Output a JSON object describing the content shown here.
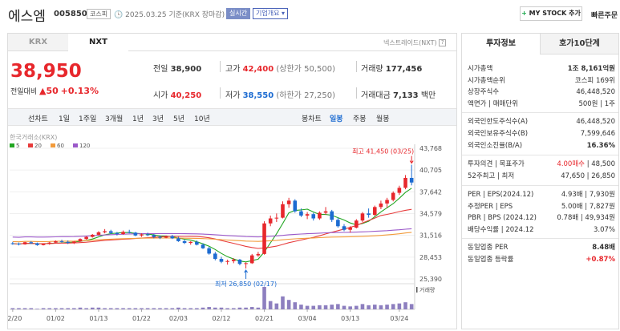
{
  "header": {
    "name": "에스엠",
    "code": "005850",
    "market": "코스피",
    "date_text": "2025.03.25 기준(KRX 장마감)",
    "realtime": "실시간",
    "company_info": "기업개요",
    "mystock": "MY STOCK 추가",
    "quick_order": "빠른주문"
  },
  "tabs": {
    "krx": "KRX",
    "nxt": "NXT",
    "nextrade": "넥스트레이드(NXT)"
  },
  "price": {
    "current": "38,950",
    "change_label": "전일대비",
    "change": "▲50",
    "change_pct": "+0.13%"
  },
  "quote": {
    "prev_label": "전일",
    "prev": "38,900",
    "high_label": "고가",
    "high": "42,400",
    "upper_label": "(상한가",
    "upper": "50,500)",
    "volume_label": "거래량",
    "volume": "177,456",
    "open_label": "시가",
    "open": "40,250",
    "low_label": "저가",
    "low": "38,550",
    "lower_label": "(하한가",
    "lower": "27,250)",
    "amount_label": "거래대금",
    "amount": "7,133",
    "amount_unit": "백만"
  },
  "periods": [
    "선차트",
    "1일",
    "1주일",
    "3개월",
    "1년",
    "3년",
    "5년",
    "10년"
  ],
  "chart_tabs": [
    "봉차트",
    "일봉",
    "주봉",
    "월봉"
  ],
  "chart_labels": {
    "source": "한국거래소(KRX)",
    "ma": [
      "5",
      "20",
      "60",
      "120"
    ],
    "ma_colors": [
      "#22a622",
      "#e73b3b",
      "#f29b3b",
      "#9b59c9"
    ],
    "max_label": "최고 41,450 (03/25)",
    "min_label": "최저 26,850 (02/17)",
    "volume_label": "거래량"
  },
  "chart_data": {
    "type": "candlestick",
    "y_ticks": [
      "43,768",
      "40,705",
      "37,642",
      "34,579",
      "31,516",
      "28,453",
      "25,390"
    ],
    "x_ticks": [
      "12/20",
      "01/02",
      "01/13",
      "01/22",
      "02/03",
      "02/12",
      "02/21",
      "03/04",
      "03/13",
      "03/24"
    ],
    "ylim": [
      25390,
      43768
    ],
    "candles": [
      [
        30400,
        30600,
        30200,
        30350
      ],
      [
        30350,
        30500,
        30100,
        30250
      ],
      [
        30250,
        30600,
        30200,
        30550
      ],
      [
        30550,
        30700,
        30300,
        30400
      ],
      [
        30400,
        30500,
        30050,
        30150
      ],
      [
        30150,
        30400,
        30100,
        30350
      ],
      [
        30350,
        30600,
        30200,
        30500
      ],
      [
        30500,
        30800,
        30400,
        30700
      ],
      [
        30700,
        30900,
        30500,
        30600
      ],
      [
        30600,
        30800,
        30300,
        30450
      ],
      [
        30450,
        30700,
        30300,
        30650
      ],
      [
        30650,
        31100,
        30600,
        31000
      ],
      [
        31000,
        31400,
        30900,
        31300
      ],
      [
        31300,
        31700,
        31200,
        31600
      ],
      [
        31600,
        32100,
        31500,
        31950
      ],
      [
        31950,
        32400,
        31800,
        32100
      ],
      [
        32100,
        32300,
        31700,
        31850
      ],
      [
        31850,
        32000,
        31500,
        31700
      ],
      [
        31700,
        32200,
        31600,
        32000
      ],
      [
        32000,
        32300,
        31800,
        31900
      ],
      [
        31900,
        32000,
        31400,
        31500
      ],
      [
        31500,
        31800,
        31300,
        31650
      ],
      [
        31650,
        31900,
        31400,
        31550
      ],
      [
        31550,
        31700,
        31100,
        31300
      ],
      [
        31300,
        31500,
        31000,
        31200
      ],
      [
        31200,
        31500,
        31100,
        31400
      ],
      [
        31400,
        31600,
        31000,
        31100
      ],
      [
        31100,
        31300,
        30600,
        30700
      ],
      [
        30700,
        30900,
        30300,
        30450
      ],
      [
        30450,
        30700,
        30200,
        30600
      ],
      [
        30600,
        30800,
        30100,
        30200
      ],
      [
        30200,
        30400,
        29600,
        29700
      ],
      [
        29700,
        29900,
        28800,
        28950
      ],
      [
        28950,
        29200,
        28000,
        28200
      ],
      [
        28200,
        28500,
        27600,
        27800
      ],
      [
        27800,
        28100,
        27400,
        27900
      ],
      [
        27900,
        28300,
        27600,
        28100
      ],
      [
        28100,
        28200,
        27300,
        27500
      ],
      [
        27500,
        27700,
        26850,
        27600
      ],
      [
        27600,
        28900,
        27500,
        28700
      ],
      [
        28700,
        29200,
        28500,
        28900
      ],
      [
        28900,
        33500,
        28800,
        33200
      ],
      [
        33200,
        34300,
        32800,
        33900
      ],
      [
        33900,
        34600,
        33400,
        34000
      ],
      [
        34000,
        36300,
        33900,
        35900
      ],
      [
        35900,
        36800,
        35400,
        36400
      ],
      [
        36400,
        36600,
        34700,
        34900
      ],
      [
        34900,
        35300,
        34100,
        34300
      ],
      [
        34300,
        34800,
        33800,
        34500
      ],
      [
        34500,
        34700,
        33600,
        33900
      ],
      [
        33900,
        34900,
        33700,
        34700
      ],
      [
        34700,
        35500,
        34400,
        34900
      ],
      [
        34900,
        35100,
        33400,
        33700
      ],
      [
        33700,
        34000,
        32600,
        32800
      ],
      [
        32800,
        33100,
        32100,
        32300
      ],
      [
        32300,
        32800,
        31900,
        32600
      ],
      [
        32600,
        33800,
        32500,
        33600
      ],
      [
        33600,
        34800,
        33400,
        34600
      ],
      [
        34600,
        35300,
        34000,
        34400
      ],
      [
        34400,
        35700,
        34200,
        35500
      ],
      [
        35500,
        36400,
        35200,
        36000
      ],
      [
        36000,
        36800,
        35400,
        36500
      ],
      [
        36500,
        37700,
        36300,
        37500
      ],
      [
        37500,
        38500,
        37200,
        38200
      ],
      [
        38200,
        40000,
        38000,
        39600
      ],
      [
        39600,
        41450,
        38550,
        38950
      ]
    ],
    "volumes": [
      2,
      2,
      2,
      2,
      1,
      2,
      2,
      2,
      2,
      2,
      2,
      3,
      2,
      3,
      3,
      2,
      2,
      2,
      2,
      2,
      2,
      2,
      2,
      2,
      2,
      2,
      2,
      3,
      2,
      2,
      2,
      3,
      4,
      3,
      3,
      2,
      2,
      3,
      3,
      4,
      3,
      38,
      14,
      10,
      22,
      16,
      12,
      8,
      6,
      6,
      7,
      7,
      8,
      9,
      6,
      5,
      6,
      9,
      7,
      8,
      7,
      8,
      9,
      10,
      12,
      9
    ]
  },
  "invest": {
    "tab1": "투자정보",
    "tab2": "호가10단계",
    "rows1": [
      {
        "label": "시가총액",
        "value": "1조 8,161억원"
      },
      {
        "label": "시가총액순위",
        "value": "코스피 169위"
      },
      {
        "label": "상장주식수",
        "value": "46,448,520"
      },
      {
        "label": "액면가 | 매매단위",
        "value": "500원 | 1주"
      }
    ],
    "rows2": [
      {
        "label": "외국인한도주식수(A)",
        "value": "46,448,520"
      },
      {
        "label": "외국인보유주식수(B)",
        "value": "7,599,646"
      },
      {
        "label": "외국인소진율(B/A)",
        "value": "16.36%"
      }
    ],
    "rows3": [
      {
        "label": "투자의견 | 목표주가",
        "value_red": "4.00매수",
        "value": "| 48,500"
      },
      {
        "label": "52주최고 | 최저",
        "value": "47,650 | 26,850"
      }
    ],
    "rows4": [
      {
        "label": "PER | EPS(2024.12)",
        "value": "4.93배 | 7,930원"
      },
      {
        "label": "추정PER | EPS",
        "value": "5.00배 | 7,827원"
      },
      {
        "label": "PBR | BPS (2024.12)",
        "value": "0.78배 | 49,934원"
      },
      {
        "label": "배당수익률 | 2024.12",
        "value": "3.07%"
      }
    ],
    "rows5": [
      {
        "label": "동일업종 PER",
        "value": "8.48배"
      },
      {
        "label": "동일업종 등락률",
        "value": "+0.87%"
      }
    ]
  }
}
